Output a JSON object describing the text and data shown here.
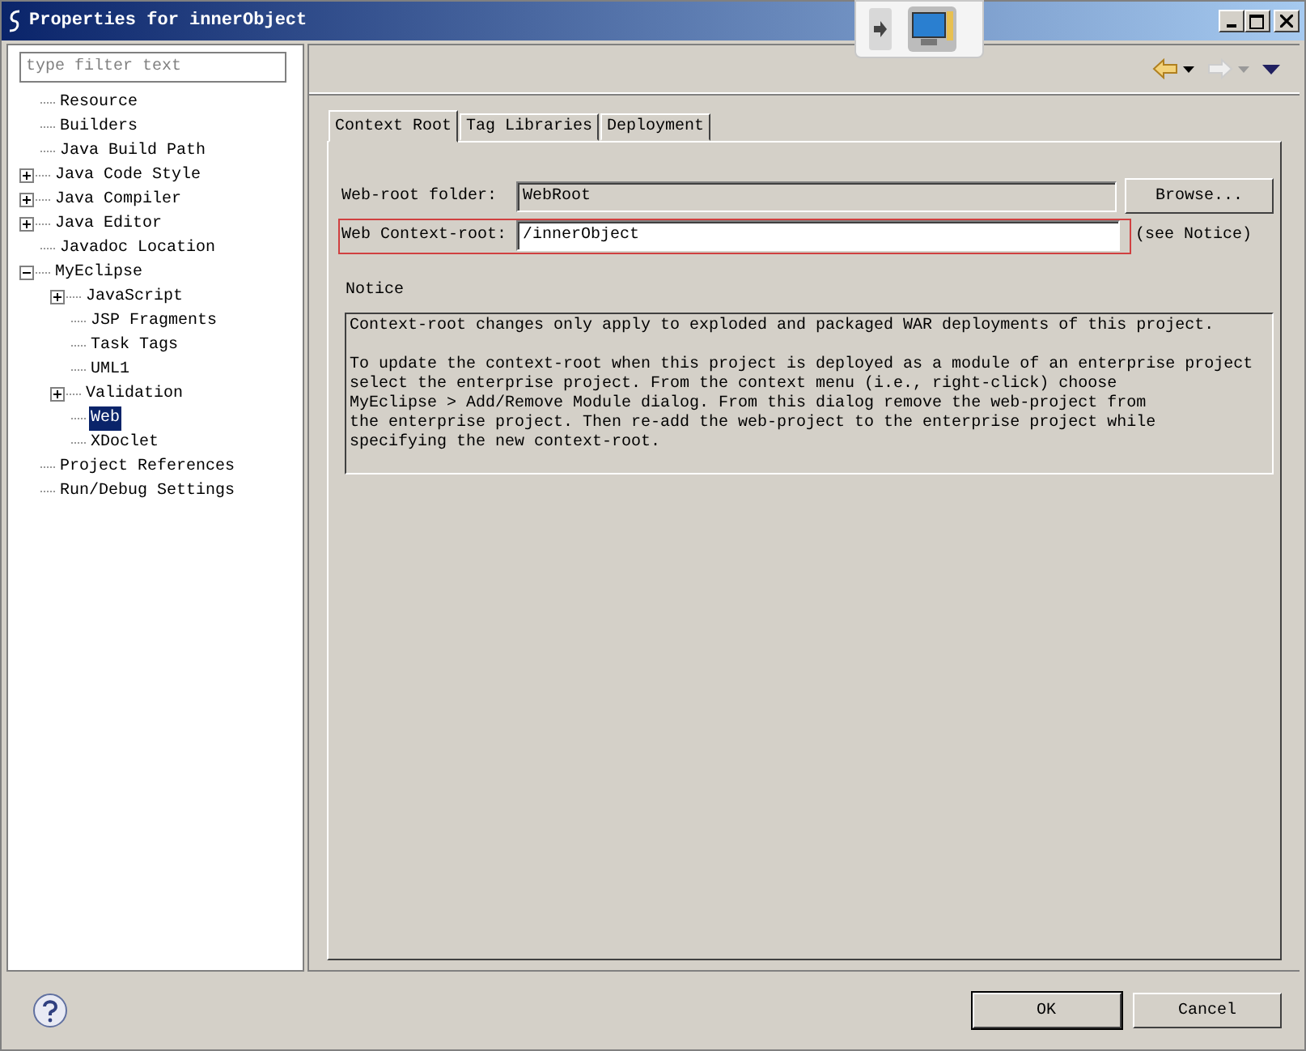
{
  "window": {
    "title": "Properties for innerObject"
  },
  "filter": {
    "placeholder": "type filter text"
  },
  "tree": [
    {
      "label": "Resource",
      "kind": "leaf",
      "selected": false
    },
    {
      "label": "Builders",
      "kind": "leaf",
      "selected": false
    },
    {
      "label": "Java Build Path",
      "kind": "leaf",
      "selected": false
    },
    {
      "label": "Java Code Style",
      "kind": "folder",
      "expanded": false,
      "selected": false
    },
    {
      "label": "Java Compiler",
      "kind": "folder",
      "expanded": false,
      "selected": false
    },
    {
      "label": "Java Editor",
      "kind": "folder",
      "expanded": false,
      "selected": false
    },
    {
      "label": "Javadoc Location",
      "kind": "leaf",
      "selected": false
    },
    {
      "label": "MyEclipse",
      "kind": "folder",
      "expanded": true,
      "selected": false,
      "children": [
        {
          "label": "JavaScript",
          "kind": "folder",
          "expanded": false,
          "selected": false
        },
        {
          "label": "JSP Fragments",
          "kind": "leaf",
          "selected": false
        },
        {
          "label": "Task Tags",
          "kind": "leaf",
          "selected": false
        },
        {
          "label": "UML1",
          "kind": "leaf",
          "selected": false
        },
        {
          "label": "Validation",
          "kind": "folder",
          "expanded": false,
          "selected": false
        },
        {
          "label": "Web",
          "kind": "leaf",
          "selected": true
        },
        {
          "label": "XDoclet",
          "kind": "leaf",
          "selected": false
        }
      ]
    },
    {
      "label": "Project References",
      "kind": "leaf",
      "selected": false
    },
    {
      "label": "Run/Debug Settings",
      "kind": "leaf",
      "selected": false
    }
  ],
  "tabs": [
    {
      "label": "Context Root",
      "selected": true
    },
    {
      "label": "Tag Libraries",
      "selected": false
    },
    {
      "label": "Deployment",
      "selected": false
    }
  ],
  "web_root": {
    "label": "Web-root folder:",
    "value": "WebRoot",
    "button": "Browse..."
  },
  "context_root": {
    "label": "Web Context-root:",
    "value": "/innerObject",
    "hint": "(see Notice)"
  },
  "notice": {
    "title": "Notice",
    "paragraphs": [
      "Context-root changes only apply to exploded and packaged WAR deployments of this project.",
      "To update the context-root when this project is deployed as a module of an enterprise project\nselect the enterprise project. From the context menu (i.e., right-click) choose\nMyEclipse > Add/Remove Module dialog. From this dialog remove the web-project from\nthe enterprise project. Then re-add the web-project to the enterprise project while\nspecifying the new context-root."
    ]
  },
  "buttons": [
    {
      "label": "OK",
      "default": true
    },
    {
      "label": "Cancel",
      "default": false
    }
  ]
}
